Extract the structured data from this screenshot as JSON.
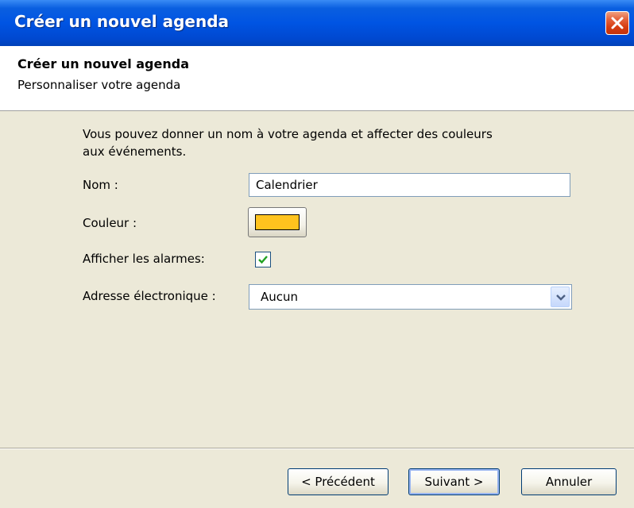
{
  "window": {
    "title": "Créer un nouvel agenda"
  },
  "header": {
    "title": "Créer un nouvel agenda",
    "subtitle": "Personnaliser votre agenda"
  },
  "form": {
    "description_line1": "Vous pouvez donner un nom à votre agenda et affecter des couleurs",
    "description_line2": "aux événements.",
    "name_label": "Nom :",
    "name_value": "Calendrier",
    "color_label": "Couleur :",
    "color_value": "#ffc31e",
    "alarms_label": "Afficher les alarmes:",
    "alarms_checked": true,
    "email_label": "Adresse électronique :",
    "email_value": "Aucun"
  },
  "buttons": {
    "back": "< Précédent",
    "next": "Suivant >",
    "cancel": "Annuler"
  },
  "icons": {
    "close": "close-icon",
    "check": "checkmark-icon",
    "dropdown": "chevron-down-icon"
  }
}
